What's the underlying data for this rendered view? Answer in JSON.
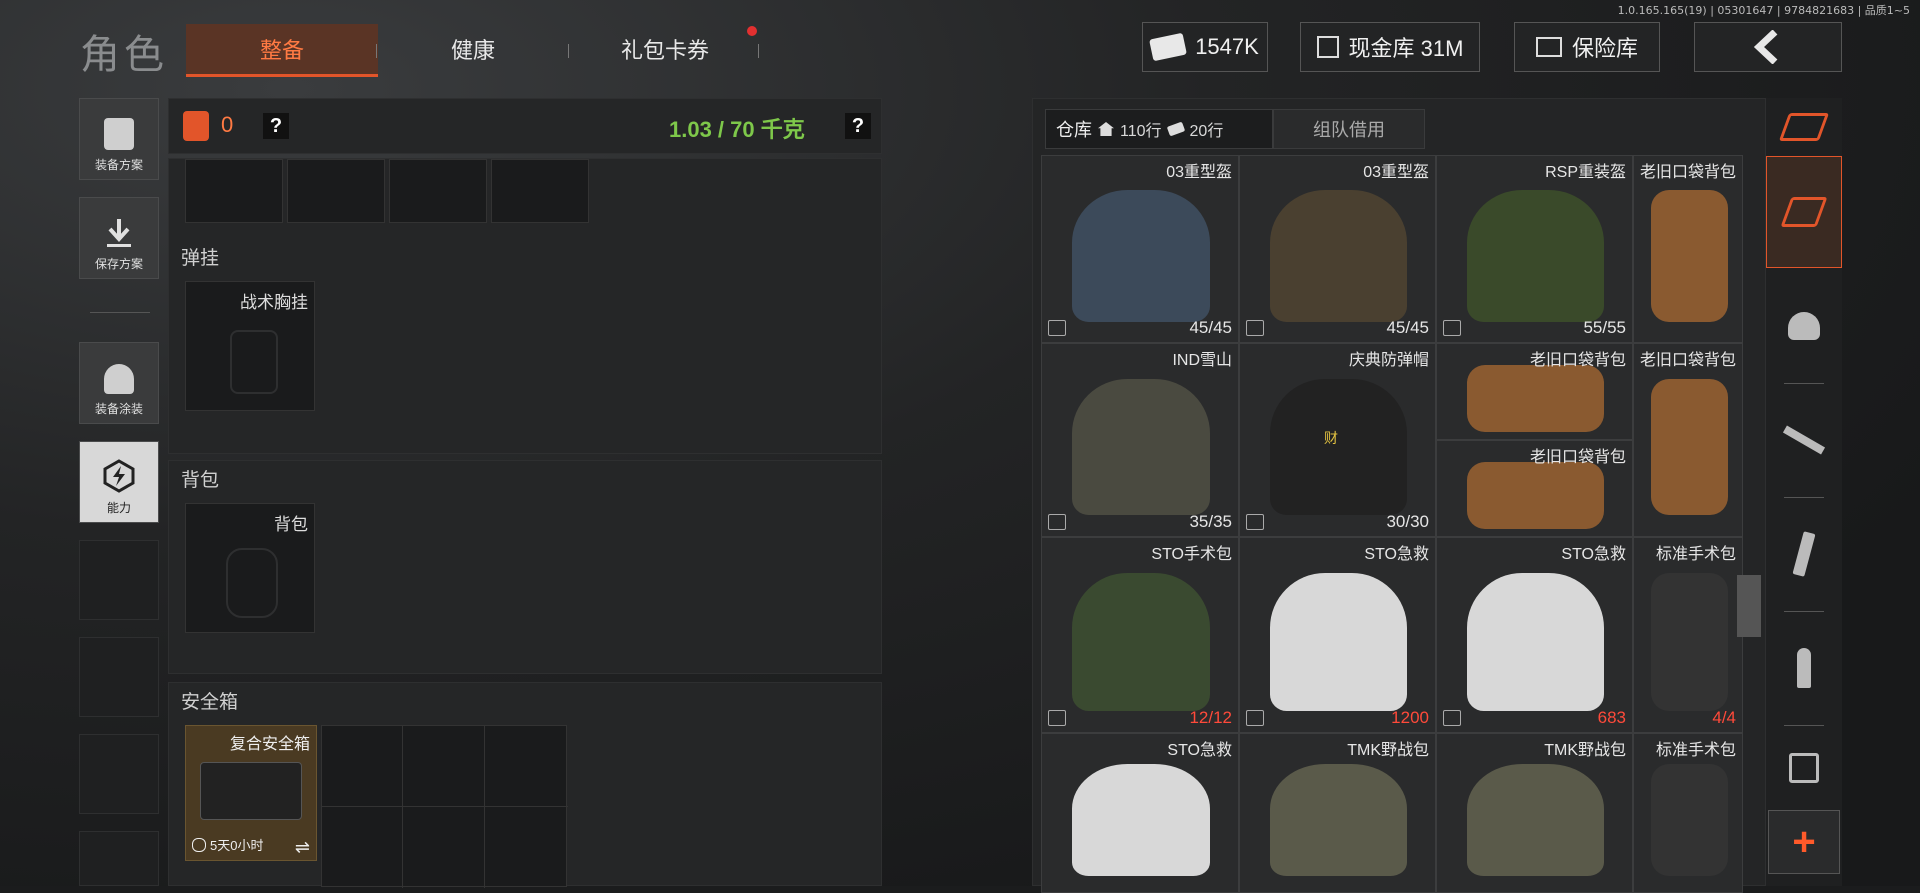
{
  "version": "1.0.165.165(19) | 05301647 | 9784821683 | 品质1~5",
  "header": {
    "title": "角色",
    "tabs": [
      {
        "label": "整备",
        "active": true
      },
      {
        "label": "健康",
        "active": false
      },
      {
        "label": "礼包卡券",
        "active": false,
        "badge": true
      }
    ],
    "money": "1547K",
    "cash_vault": "现金库 31M",
    "insurance": "保险库",
    "back_icon": "chevron-left-icon"
  },
  "left_sidebar": [
    {
      "label": "装备方案",
      "icon": "vest-icon"
    },
    {
      "label": "保存方案",
      "icon": "download-icon"
    },
    {
      "label": "装备涂装",
      "icon": "helmet-paint-icon"
    },
    {
      "label": "能力",
      "icon": "lightning-hex-icon"
    }
  ],
  "equipment": {
    "armor_count": "0",
    "help": "?",
    "weight": "1.03 / 70 千克",
    "sections": {
      "chest_rig": {
        "title": "弹挂",
        "slot_label": "战术胸挂"
      },
      "backpack": {
        "title": "背包",
        "slot_label": "背包"
      },
      "safebox": {
        "title": "安全箱",
        "item_name": "复合安全箱",
        "timer": "5天0小时",
        "swap_icon": "⇌"
      }
    }
  },
  "warehouse": {
    "tabs": {
      "storage": "仓库",
      "rows_home": "110行",
      "rows_ticket": "20行",
      "team_borrow": "组队借用"
    },
    "items": [
      {
        "name": "03重型盔",
        "count": "45/45",
        "red": false
      },
      {
        "name": "03重型盔",
        "count": "45/45",
        "red": false
      },
      {
        "name": "RSP重装盔",
        "count": "55/55",
        "red": false
      },
      {
        "name": "老旧口袋背包",
        "count": "",
        "red": false
      },
      {
        "name": "IND雪山",
        "count": "35/35",
        "red": false
      },
      {
        "name": "庆典防弹帽",
        "count": "30/30",
        "red": false
      },
      {
        "name": "老旧口袋背包",
        "count": "",
        "red": false
      },
      {
        "name": "老旧口袋背包",
        "count": "",
        "red": false
      },
      {
        "name": "老旧口袋背包",
        "count": "",
        "red": false
      },
      {
        "name": "STO手术包",
        "count": "12/12",
        "red": true
      },
      {
        "name": "STO急救",
        "count": "1200",
        "red": true
      },
      {
        "name": "STO急救",
        "count": "683",
        "red": true
      },
      {
        "name": "标准手术包",
        "count": "4/4",
        "red": true
      },
      {
        "name": "STO急救",
        "count": "",
        "red": false
      },
      {
        "name": "TMK野战包",
        "count": "",
        "red": false
      },
      {
        "name": "TMK野战包",
        "count": "",
        "red": false
      },
      {
        "name": "标准手术包",
        "count": "",
        "red": false
      }
    ],
    "cap_emblem": "财"
  },
  "right_sidebar": {
    "icons": [
      "layers-refresh-icon",
      "layers-download-icon",
      "helmet-icon",
      "rifle-icon",
      "magazine-icon",
      "ammo-icon",
      "scope-icon"
    ],
    "add": "+"
  },
  "colors": {
    "accent_orange": "#e2552a",
    "weight_green": "#7ec84a",
    "count_red": "#ff4a3a"
  }
}
